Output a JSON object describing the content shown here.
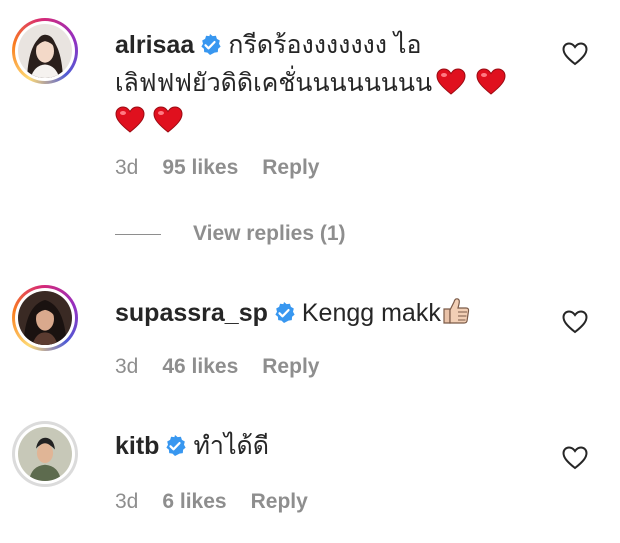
{
  "comments": [
    {
      "username": "alrisaa",
      "text_line1": "กรีดร้องงงงงงง ไอ",
      "text_line2": "เลิฟฟฟยัวดิดิเคชั่นนนนนนนน",
      "emoji": "heart",
      "time": "3d",
      "likes": "95 likes",
      "reply": "Reply",
      "view_replies": "View replies (1)"
    },
    {
      "username": "supassra_sp",
      "text": "Kengg makk",
      "emoji": "thumbs-up",
      "time": "3d",
      "likes": "46 likes",
      "reply": "Reply"
    },
    {
      "username": "kitb",
      "text": "ทำได้ดี",
      "time": "3d",
      "likes": "6 likes",
      "reply": "Reply"
    }
  ],
  "colors": {
    "verified": "#3897f0",
    "heart_emoji": "#e0101e",
    "muted": "#8e8e8e",
    "text": "#262626"
  }
}
